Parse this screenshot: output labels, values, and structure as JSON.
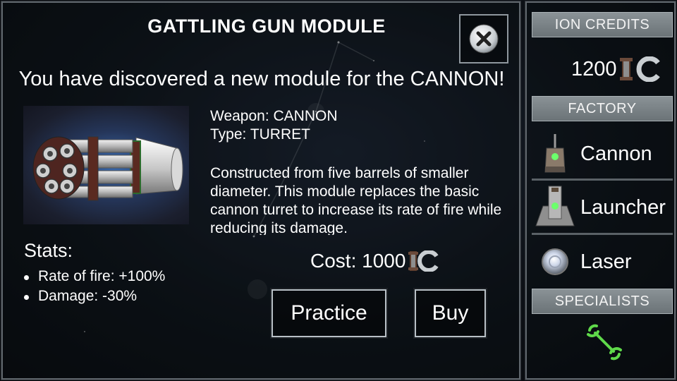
{
  "dialog": {
    "title": "GATTLING GUN MODULE",
    "subtitle": "You have discovered a new module for the CANNON!",
    "weapon_line": "Weapon: CANNON",
    "type_line": "Type: TURRET",
    "description": "Constructed from five barrels of smaller diameter. This module replaces the basic cannon turret to increase its rate of fire while reducing its damage.",
    "stats_title": "Stats:",
    "stats": [
      "Rate of fire: +100%",
      "Damage: -30%"
    ],
    "cost_label": "Cost: 1000",
    "practice_label": "Practice",
    "buy_label": "Buy",
    "close_icon": "close-x-icon"
  },
  "sidebar": {
    "credits_header": "ION CREDITS",
    "credits_value": "1200",
    "factory_header": "FACTORY",
    "factory_items": [
      {
        "label": "Cannon",
        "icon": "cannon-turret-icon"
      },
      {
        "label": "Launcher",
        "icon": "launcher-turret-icon"
      },
      {
        "label": "Laser",
        "icon": "laser-orb-icon"
      }
    ],
    "specialists_header": "SPECIALISTS",
    "specialist_icon": "wrench-icon"
  },
  "colors": {
    "panel_border": "#5f666c",
    "header_bg": "#7b8387",
    "wrench_green": "#5fd94a"
  }
}
